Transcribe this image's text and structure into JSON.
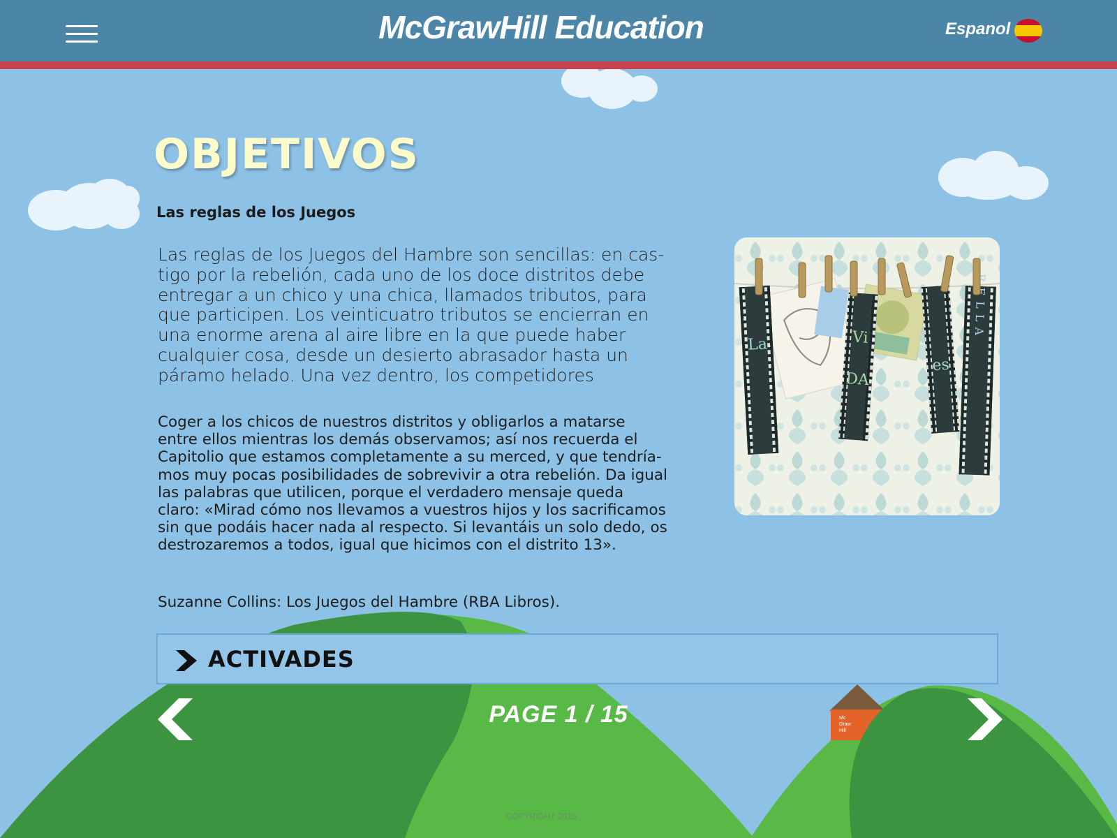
{
  "header": {
    "brand": "McGrawHill Education",
    "language_label": "Espanol",
    "flag_icon": "spain-flag-icon",
    "menu_icon": "hamburger-menu-icon"
  },
  "main": {
    "heading": "OBJETIVOS",
    "subtitle": "Las reglas de los Juegos",
    "paragraph1_lines": [
      "Las reglas de los Juegos del Hambre son sencillas: en cas-",
      "tigo por la rebelión, cada uno de los doce distritos debe",
      "entregar a un chico y una chica, llamados tributos, para",
      "que participen. Los veinticuatro tributos se encierran en",
      "una enorme arena al aire libre en la que puede haber",
      "cualquier cosa, desde un desierto abrasador hasta un",
      "páramo helado. Una vez dentro, los competidores"
    ],
    "paragraph2_lines": [
      "Coger a los chicos de nuestros distritos y obligarlos a matarse",
      "entre ellos mientras los demás observamos; así nos recuerda el",
      "Capitolio que estamos completamente a su merced, y que tendría-",
      "mos muy pocas posibilidades de sobrevivir a otra rebelión. Da igual",
      "las palabras que utilicen, porque el verdadero mensaje queda",
      "claro: «Mirad cómo nos llevamos a vuestros hijos y los sacrificamos",
      "sin que podáis hacer nada al respecto. Si levantáis un solo dedo, os",
      "destrozaremos a todos, igual que hicimos con el distrito 13»."
    ],
    "credit": "Suzanne Collins: Los Juegos del Hambre (RBA Libros).",
    "illustration_letters": [
      "La",
      "Vi",
      "DA",
      "es",
      "BELLA"
    ]
  },
  "activities": {
    "label": "ACTIVADES",
    "icon": "chevron-right-icon"
  },
  "navigation": {
    "page_label": "PAGE 1 / 15",
    "current_page": 1,
    "total_pages": 15,
    "prev_icon": "arrow-left-icon",
    "next_icon": "arrow-right-icon"
  },
  "footer": {
    "copyright": "COPYRIGHT 2015"
  },
  "colors": {
    "header": "#4b86a8",
    "header_stripe": "#c9414a",
    "sky": "#8dc2e6",
    "heading": "#fdfbc9",
    "hill_light": "#58b947",
    "hill_dark": "#3c9441"
  }
}
